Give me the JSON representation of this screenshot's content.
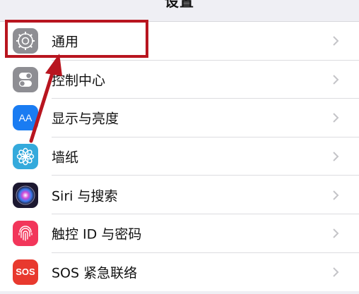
{
  "nav": {
    "title": "设置"
  },
  "rows": [
    {
      "label": "通用",
      "icon": "gear-icon",
      "color": "#8e8e93"
    },
    {
      "label": "控制中心",
      "icon": "toggles-icon",
      "color": "#8e8e93"
    },
    {
      "label": "显示与亮度",
      "icon": "text-size-icon",
      "color": "#1a7cf2"
    },
    {
      "label": "墙纸",
      "icon": "flower-icon",
      "color": "#34aadc"
    },
    {
      "label": "Siri 与搜索",
      "icon": "siri-icon",
      "color": "#2a2340"
    },
    {
      "label": "触控 ID 与密码",
      "icon": "fingerprint-icon",
      "color": "#f2365a"
    },
    {
      "label": "SOS 紧急联络",
      "icon": "sos-icon",
      "color": "#e8392e"
    }
  ],
  "icon_text": {
    "display": "AA",
    "sos": "SOS"
  },
  "annotation": {
    "color": "#b8151f"
  }
}
